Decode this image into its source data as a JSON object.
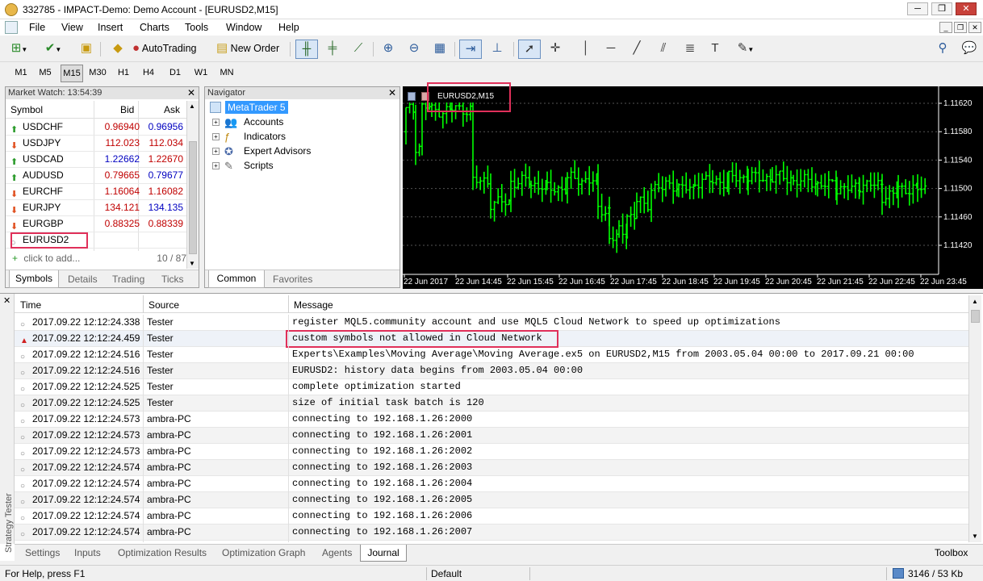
{
  "window": {
    "title": "332785 - IMPACT-Demo: Demo Account - [EURUSD2,M15]"
  },
  "menu": [
    "File",
    "View",
    "Insert",
    "Charts",
    "Tools",
    "Window",
    "Help"
  ],
  "toolbar": {
    "autotrading_label": "AutoTrading",
    "new_order_label": "New Order"
  },
  "timeframes": [
    "M1",
    "M5",
    "M15",
    "M30",
    "H1",
    "H4",
    "D1",
    "W1",
    "MN"
  ],
  "active_timeframe": "M15",
  "market_watch": {
    "title": "Market Watch: 13:54:39",
    "columns": {
      "symbol": "Symbol",
      "bid": "Bid",
      "ask": "Ask"
    },
    "rows": [
      {
        "symbol": "USDCHF",
        "bid": "0.96940",
        "ask": "0.96956",
        "dir": "up",
        "bid_color": "#c00000",
        "ask_color": "#0000c0"
      },
      {
        "symbol": "USDJPY",
        "bid": "112.023",
        "ask": "112.034",
        "dir": "down",
        "bid_color": "#c00000",
        "ask_color": "#c00000"
      },
      {
        "symbol": "USDCAD",
        "bid": "1.22662",
        "ask": "1.22670",
        "dir": "up",
        "bid_color": "#0000c0",
        "ask_color": "#c00000"
      },
      {
        "symbol": "AUDUSD",
        "bid": "0.79665",
        "ask": "0.79677",
        "dir": "up",
        "bid_color": "#c00000",
        "ask_color": "#0000c0"
      },
      {
        "symbol": "EURCHF",
        "bid": "1.16064",
        "ask": "1.16082",
        "dir": "down",
        "bid_color": "#c00000",
        "ask_color": "#c00000"
      },
      {
        "symbol": "EURJPY",
        "bid": "134.121",
        "ask": "134.135",
        "dir": "down",
        "bid_color": "#c00000",
        "ask_color": "#0000c0"
      },
      {
        "symbol": "EURGBP",
        "bid": "0.88325",
        "ask": "0.88339",
        "dir": "down",
        "bid_color": "#c00000",
        "ask_color": "#c00000"
      },
      {
        "symbol": "EURUSD2",
        "bid": "",
        "ask": "",
        "dir": "none",
        "bid_color": "#000",
        "ask_color": "#000"
      }
    ],
    "add_label": "click to add...",
    "count": "10 / 87",
    "tabs": [
      "Symbols",
      "Details",
      "Trading",
      "Ticks"
    ],
    "active_tab": "Symbols"
  },
  "navigator": {
    "title": "Navigator",
    "root": "MetaTrader 5",
    "items": [
      "Accounts",
      "Indicators",
      "Expert Advisors",
      "Scripts"
    ],
    "tabs": [
      "Common",
      "Favorites"
    ],
    "active_tab": "Common"
  },
  "chart": {
    "label": "EURUSD2,M15",
    "price_ticks": [
      "1.11620",
      "1.11580",
      "1.11540",
      "1.11500",
      "1.11460",
      "1.11420"
    ],
    "time_ticks": [
      "22 Jun 2017",
      "22 Jun 14:45",
      "22 Jun 15:45",
      "22 Jun 16:45",
      "22 Jun 17:45",
      "22 Jun 18:45",
      "22 Jun 19:45",
      "22 Jun 20:45",
      "22 Jun 21:45",
      "22 Jun 22:45",
      "22 Jun 23:45"
    ]
  },
  "journal": {
    "columns": {
      "time": "Time",
      "source": "Source",
      "message": "Message"
    },
    "rows": [
      {
        "time": "2017.09.22 12:12:24.338",
        "source": "Tester",
        "message": "register MQL5.community account and use MQL5 Cloud Network to speed up optimizations",
        "level": "info"
      },
      {
        "time": "2017.09.22 12:12:24.459",
        "source": "Tester",
        "message": "custom symbols not allowed in Cloud Network",
        "level": "warning"
      },
      {
        "time": "2017.09.22 12:12:24.516",
        "source": "Tester",
        "message": "Experts\\Examples\\Moving Average\\Moving Average.ex5 on EURUSD2,M15 from 2003.05.04 00:00 to 2017.09.21 00:00",
        "level": "info"
      },
      {
        "time": "2017.09.22 12:12:24.516",
        "source": "Tester",
        "message": "EURUSD2: history data begins from 2003.05.04 00:00",
        "level": "info"
      },
      {
        "time": "2017.09.22 12:12:24.525",
        "source": "Tester",
        "message": "complete optimization started",
        "level": "info"
      },
      {
        "time": "2017.09.22 12:12:24.525",
        "source": "Tester",
        "message": "size of initial task batch is 120",
        "level": "info"
      },
      {
        "time": "2017.09.22 12:12:24.573",
        "source": "ambra-PC",
        "message": "connecting to 192.168.1.26:2000",
        "level": "info"
      },
      {
        "time": "2017.09.22 12:12:24.573",
        "source": "ambra-PC",
        "message": "connecting to 192.168.1.26:2001",
        "level": "info"
      },
      {
        "time": "2017.09.22 12:12:24.573",
        "source": "ambra-PC",
        "message": "connecting to 192.168.1.26:2002",
        "level": "info"
      },
      {
        "time": "2017.09.22 12:12:24.574",
        "source": "ambra-PC",
        "message": "connecting to 192.168.1.26:2003",
        "level": "info"
      },
      {
        "time": "2017.09.22 12:12:24.574",
        "source": "ambra-PC",
        "message": "connecting to 192.168.1.26:2004",
        "level": "info"
      },
      {
        "time": "2017.09.22 12:12:24.574",
        "source": "ambra-PC",
        "message": "connecting to 192.168.1.26:2005",
        "level": "info"
      },
      {
        "time": "2017.09.22 12:12:24.574",
        "source": "ambra-PC",
        "message": "connecting to 192.168.1.26:2006",
        "level": "info"
      },
      {
        "time": "2017.09.22 12:12:24.574",
        "source": "ambra-PC",
        "message": "connecting to 192.168.1.26:2007",
        "level": "info"
      }
    ],
    "side_label": "Strategy Tester",
    "tabs": [
      "Settings",
      "Inputs",
      "Optimization Results",
      "Optimization Graph",
      "Agents",
      "Journal"
    ],
    "active_tab": "Journal",
    "toolbox_label": "Toolbox"
  },
  "status": {
    "help": "For Help, press F1",
    "profile": "Default",
    "traffic": "3146 / 53 Kb"
  },
  "colors": {
    "highlight_box": "#e0305a",
    "chart_bg": "#000000",
    "candle": "#00ff00",
    "selection": "#3399ff"
  }
}
